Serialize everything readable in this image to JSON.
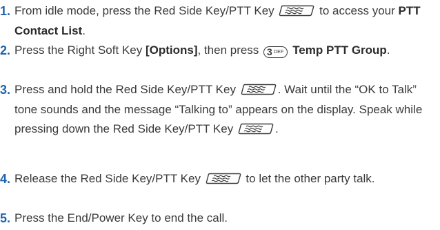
{
  "steps": [
    {
      "number": "1.",
      "parts": {
        "a": "From idle mode, press the Red Side Key/PTT Key",
        "b": "to access your",
        "c": "PTT Contact List",
        "d": "."
      }
    },
    {
      "number": "2.",
      "parts": {
        "a": "Press the Right Soft Key",
        "b": "[Options]",
        "c": ", then press",
        "d": "Temp PTT Group",
        "e": "."
      },
      "key": {
        "digit": "3",
        "letters": "DEF"
      }
    },
    {
      "number": "3.",
      "parts": {
        "a": "Press and hold the Red Side Key/PTT Key",
        "b": ". Wait until the “OK to Talk” tone sounds and the message “Talking to” appears on the display. Speak while pressing down the Red Side Key/PTT Key",
        "c": "."
      }
    },
    {
      "number": "4.",
      "parts": {
        "a": "Release the Red Side Key/PTT Key",
        "b": "to let the other party talk."
      }
    },
    {
      "number": "5.",
      "parts": {
        "a": "Press the End/Power Key to end the call."
      }
    }
  ],
  "icons": {
    "ptt_key": "ptt-key-icon",
    "keypad_key": "keypad-3-key-icon"
  },
  "colors": {
    "step_number": "#1f63ad",
    "text": "#3a3a3a"
  }
}
